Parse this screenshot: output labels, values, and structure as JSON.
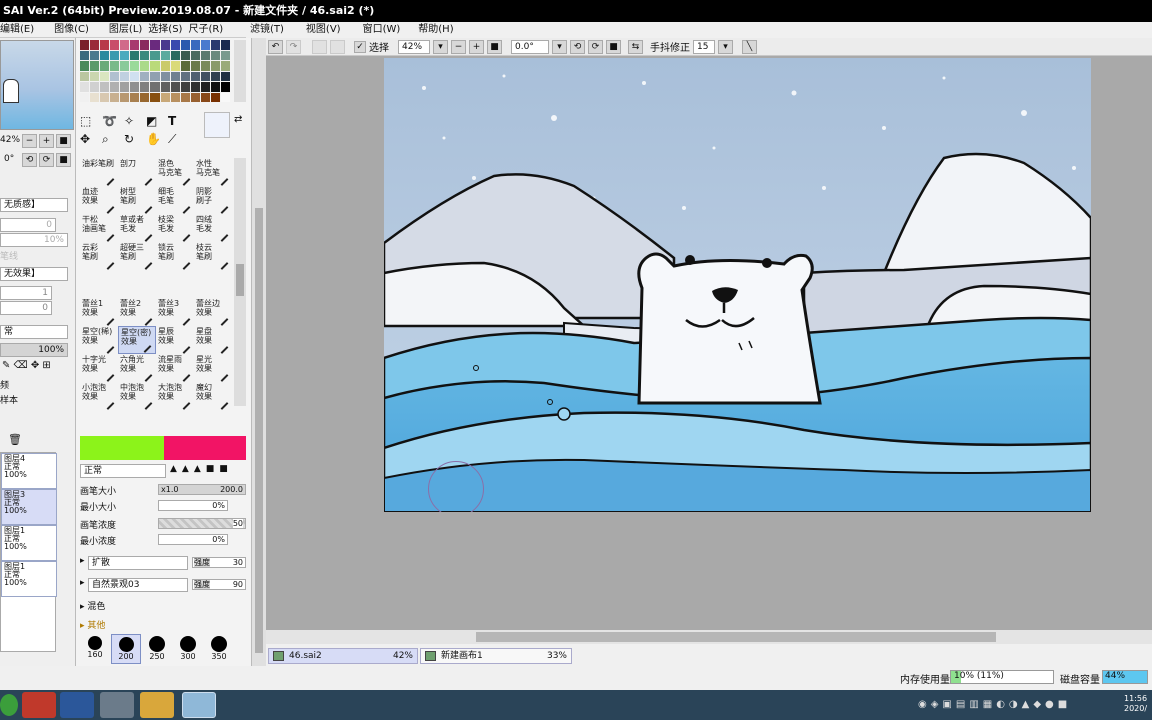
{
  "window": {
    "title": "SAI Ver.2 (64bit) Preview.2019.08.07 - 新建文件夹 / 46.sai2 (*)"
  },
  "menu": {
    "left": [
      "编辑(E)",
      "图像(C)",
      "图层(L)",
      "选择(S)",
      "尺子(R)"
    ],
    "right": [
      "滤镜(T)",
      "视图(V)",
      "窗口(W)",
      "帮助(H)"
    ]
  },
  "toolbar": {
    "select_label": "选择",
    "zoom": "42%",
    "rotation": "0.0°",
    "stabilizer_label": "手抖修正",
    "stabilizer_value": "15"
  },
  "navigator": {
    "zoom": "42%",
    "angle": "0°"
  },
  "left_panel": {
    "texture_1": "无质感】",
    "texture_2": "无效果】",
    "blend_partial": "常",
    "opacity": "100%",
    "label_a": "频",
    "label_b": "样本",
    "faded_label": "笔线"
  },
  "layers": [
    {
      "name": "图层4",
      "mode": "正常",
      "opacity": "100%"
    },
    {
      "name": "图层3",
      "mode": "正常",
      "opacity": "100%"
    },
    {
      "name": "图层1",
      "mode": "正常",
      "opacity": "100%"
    },
    {
      "name": "图层1",
      "mode": "正常",
      "opacity": "100%"
    }
  ],
  "brushes": [
    {
      "top": "油彩笔刷",
      "bottom": ""
    },
    {
      "top": "剖刀",
      "bottom": ""
    },
    {
      "top": "混色",
      "bottom": "马克笔"
    },
    {
      "top": "水性",
      "bottom": "马克笔"
    },
    {
      "top": "血迹",
      "bottom": "效果"
    },
    {
      "top": "树型",
      "bottom": "笔刷"
    },
    {
      "top": "细毛",
      "bottom": "毛笔"
    },
    {
      "top": "阴影",
      "bottom": "刷子"
    },
    {
      "top": "干松",
      "bottom": "油画笔"
    },
    {
      "top": "草或者",
      "bottom": "毛发"
    },
    {
      "top": "枝梁",
      "bottom": "毛发"
    },
    {
      "top": "四绒",
      "bottom": "毛发"
    },
    {
      "top": "云彩",
      "bottom": "笔刷"
    },
    {
      "top": "超硬三",
      "bottom": "笔刷"
    },
    {
      "top": "锁云",
      "bottom": "笔刷"
    },
    {
      "top": "枝云",
      "bottom": "笔刷"
    },
    {
      "top": "",
      "bottom": ""
    },
    {
      "top": "",
      "bottom": ""
    },
    {
      "top": "",
      "bottom": ""
    },
    {
      "top": "",
      "bottom": ""
    },
    {
      "top": "蕾丝1",
      "bottom": "效果"
    },
    {
      "top": "蕾丝2",
      "bottom": "效果"
    },
    {
      "top": "蕾丝3",
      "bottom": "效果"
    },
    {
      "top": "蕾丝边",
      "bottom": "效果"
    },
    {
      "top": "星空(稀)",
      "bottom": "效果"
    },
    {
      "top": "星空(密)",
      "bottom": "效果"
    },
    {
      "top": "星辰",
      "bottom": "效果"
    },
    {
      "top": "星盘",
      "bottom": "效果"
    },
    {
      "top": "十字光",
      "bottom": "效果"
    },
    {
      "top": "六角光",
      "bottom": "效果"
    },
    {
      "top": "流星雨",
      "bottom": "效果"
    },
    {
      "top": "星光",
      "bottom": "效果"
    },
    {
      "top": "小泡泡",
      "bottom": "效果"
    },
    {
      "top": "中泡泡",
      "bottom": "效果"
    },
    {
      "top": "大泡泡",
      "bottom": "效果"
    },
    {
      "top": "魔幻",
      "bottom": "效果"
    }
  ],
  "brush_settings": {
    "blend_mode": "正常",
    "size_label": "画笔大小",
    "size_mult": "x1.0",
    "size_value": "200.0",
    "min_size_label": "最小大小",
    "min_size_value": "0%",
    "density_label": "画笔浓度",
    "density_value": "50",
    "min_density_label": "最小浓度",
    "min_density_value": "0%",
    "diffuse_label": "扩散",
    "diffuse_strength_label": "强度",
    "diffuse_value": "30",
    "texture_label": "自然景观03",
    "texture_strength_label": "强度",
    "texture_value": "90",
    "mix_label": "混色",
    "other_label": "其他"
  },
  "brush_sizes": [
    "160",
    "200",
    "250",
    "300",
    "350"
  ],
  "doc_tabs": [
    {
      "name": "46.sai2",
      "zoom": "42%"
    },
    {
      "name": "新建画布1",
      "zoom": "33%"
    }
  ],
  "status": {
    "memory_label": "内存使用量",
    "memory_value": "10% (11%)",
    "disk_label": "磁盘容量",
    "disk_value": "44%"
  },
  "taskbar": {
    "clock_time": "11:56",
    "clock_date": "2020/"
  },
  "colors": {
    "primary": "#8cf31a",
    "secondary": "#f21465",
    "canvas_bg": "#a9a9a9",
    "selected_tab": "#d7dcf6"
  }
}
